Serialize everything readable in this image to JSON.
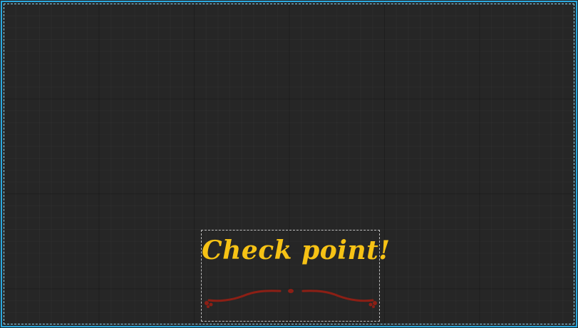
{
  "scene": {
    "checkpoint_label": "Check point!",
    "text_color": "#f6c215",
    "ornament_color": "#8c1f15",
    "ornament_icon": "flourish-divider",
    "viewport_border_color": "#2aa9e0",
    "selection_border_color": "#bdbdbd",
    "background_color": "#262626"
  }
}
